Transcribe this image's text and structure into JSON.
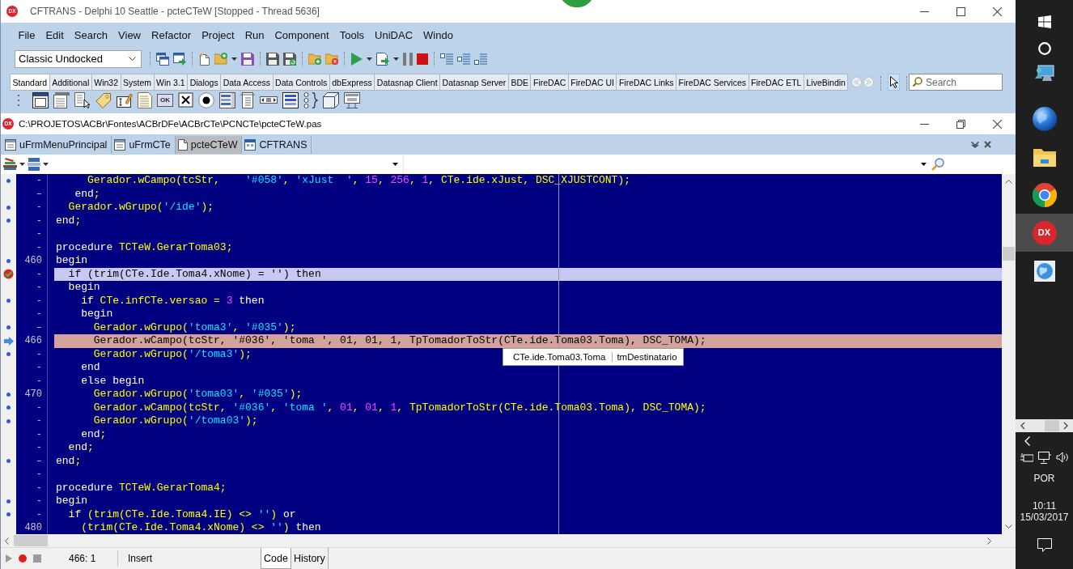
{
  "window": {
    "logo_text": "DX",
    "title": "CFTRANS - Delphi 10 Seattle - pcteCTeW [Stopped - Thread 5636]"
  },
  "menu": [
    "File",
    "Edit",
    "Search",
    "View",
    "Refactor",
    "Project",
    "Run",
    "Component",
    "Tools",
    "UniDAC",
    "Windo"
  ],
  "toolbar": {
    "desktop_layout": "Classic Undocked"
  },
  "component_palette": {
    "tabs": [
      {
        "label": "Standard",
        "selected": true
      },
      {
        "label": "Additional",
        "selected": false
      },
      {
        "label": "Win32",
        "selected": false
      },
      {
        "label": "System",
        "selected": false
      },
      {
        "label": "Win 3.1",
        "selected": false
      },
      {
        "label": "Dialogs",
        "selected": false
      },
      {
        "label": "Data Access",
        "selected": false
      },
      {
        "label": "Data Controls",
        "selected": false
      },
      {
        "label": "dbExpress",
        "selected": false
      },
      {
        "label": "Datasnap Client",
        "selected": false
      },
      {
        "label": "Datasnap Server",
        "selected": false
      },
      {
        "label": "BDE",
        "selected": false
      },
      {
        "label": "FireDAC",
        "selected": false
      },
      {
        "label": "FireDAC UI",
        "selected": false
      },
      {
        "label": "FireDAC Links",
        "selected": false
      },
      {
        "label": "FireDAC Services",
        "selected": false
      },
      {
        "label": "FireDAC ETL",
        "selected": false
      },
      {
        "label": "LiveBindin",
        "selected": false
      }
    ],
    "search": {
      "placeholder": "Search"
    },
    "button_icon_caption": "OK"
  },
  "editor": {
    "logo_text": "DX",
    "path": "C:\\PROJETOS\\ACBr\\Fontes\\ACBrDFe\\ACBrCTe\\PCNCTe\\pcteCTeW.pas",
    "tabs": [
      {
        "label": "uFrmMenuPrincipal",
        "kind": "form",
        "selected": false
      },
      {
        "label": "uFrmCTe",
        "kind": "form",
        "selected": false
      },
      {
        "label": "pcteCTeW",
        "kind": "unit",
        "selected": true
      },
      {
        "label": "CFTRANS",
        "kind": "project",
        "selected": false
      }
    ],
    "lines": [
      {
        "number": "-",
        "kind": "compiled",
        "tokens": [
          {
            "kind": "identifier",
            "text": "     Gerador.wCampo(tcStr,    "
          },
          {
            "kind": "string",
            "text": "'#058'"
          },
          {
            "kind": "identifier",
            "text": ", "
          },
          {
            "kind": "string",
            "text": "'xJust  '"
          },
          {
            "kind": "identifier",
            "text": ", "
          },
          {
            "kind": "number",
            "text": "15"
          },
          {
            "kind": "identifier",
            "text": ", "
          },
          {
            "kind": "number",
            "text": "256"
          },
          {
            "kind": "identifier",
            "text": ", "
          },
          {
            "kind": "number",
            "text": "1"
          },
          {
            "kind": "identifier",
            "text": ", CTe.ide.xJust, DSC_XJUSTCONT);"
          }
        ]
      },
      {
        "number": "–",
        "kind": "plain",
        "tokens": [
          {
            "kind": "keyword",
            "text": "   end"
          },
          {
            "kind": "identifier",
            "text": ";"
          }
        ]
      },
      {
        "number": "-",
        "kind": "compiled",
        "tokens": [
          {
            "kind": "identifier",
            "text": "  Gerador.wGrupo("
          },
          {
            "kind": "string",
            "text": "'/ide'"
          },
          {
            "kind": "identifier",
            "text": ");"
          }
        ]
      },
      {
        "number": "-",
        "kind": "compiled",
        "tokens": [
          {
            "kind": "keyword",
            "text": "end"
          },
          {
            "kind": "identifier",
            "text": ";"
          }
        ]
      },
      {
        "number": "-",
        "kind": "plain"
      },
      {
        "number": "-",
        "kind": "plain",
        "tokens": [
          {
            "kind": "keyword",
            "text": "procedure "
          },
          {
            "kind": "identifier",
            "text": "TCTeW.GerarToma03;"
          }
        ]
      },
      {
        "number": "460",
        "kind": "compiled",
        "tokens": [
          {
            "kind": "keyword",
            "text": "begin"
          }
        ]
      },
      {
        "number": "-",
        "kind": "breakpoint",
        "tokens": [
          {
            "kind": "keyword",
            "text": "  if "
          },
          {
            "kind": "identifier",
            "text": "(trim(CTe.Ide.Toma4.xNome) = "
          },
          {
            "kind": "string",
            "text": "''"
          },
          {
            "kind": "identifier",
            "text": ") "
          },
          {
            "kind": "keyword",
            "text": "then"
          }
        ]
      },
      {
        "number": "-",
        "kind": "plain",
        "tokens": [
          {
            "kind": "keyword",
            "text": "  begin"
          }
        ]
      },
      {
        "number": "-",
        "kind": "compiled",
        "tokens": [
          {
            "kind": "keyword",
            "text": "    if "
          },
          {
            "kind": "identifier",
            "text": "CTe.infCTe.versao = "
          },
          {
            "kind": "number",
            "text": "3"
          },
          {
            "kind": "keyword",
            "text": " then"
          }
        ]
      },
      {
        "number": "-",
        "kind": "plain",
        "tokens": [
          {
            "kind": "keyword",
            "text": "    begin"
          }
        ]
      },
      {
        "number": "–",
        "kind": "compiled",
        "tokens": [
          {
            "kind": "identifier",
            "text": "      Gerador.wGrupo("
          },
          {
            "kind": "string",
            "text": "'toma3'"
          },
          {
            "kind": "identifier",
            "text": ", "
          },
          {
            "kind": "string",
            "text": "'#035'"
          },
          {
            "kind": "identifier",
            "text": ");"
          }
        ]
      },
      {
        "number": "466",
        "kind": "current",
        "tokens": [
          {
            "kind": "identifier",
            "text": "      Gerador.wCampo(tcStr, "
          },
          {
            "kind": "string",
            "text": "'#036'"
          },
          {
            "kind": "identifier",
            "text": ", "
          },
          {
            "kind": "string",
            "text": "'toma '"
          },
          {
            "kind": "identifier",
            "text": ", "
          },
          {
            "kind": "number",
            "text": "01"
          },
          {
            "kind": "identifier",
            "text": ", "
          },
          {
            "kind": "number",
            "text": "01"
          },
          {
            "kind": "identifier",
            "text": ", "
          },
          {
            "kind": "number",
            "text": "1"
          },
          {
            "kind": "identifier",
            "text": ", TpTomadorToStr(CTe.ide.Toma03.Toma), DSC_TOMA);"
          }
        ]
      },
      {
        "number": "-",
        "kind": "compiled",
        "tokens": [
          {
            "kind": "identifier",
            "text": "      Gerador.wGrupo("
          },
          {
            "kind": "string",
            "text": "'/toma3'"
          },
          {
            "kind": "identifier",
            "text": ");"
          }
        ]
      },
      {
        "number": "-",
        "kind": "plain",
        "tokens": [
          {
            "kind": "keyword",
            "text": "    end"
          }
        ]
      },
      {
        "number": "-",
        "kind": "plain",
        "tokens": [
          {
            "kind": "keyword",
            "text": "    else begin"
          }
        ]
      },
      {
        "number": "470",
        "kind": "compiled",
        "tokens": [
          {
            "kind": "identifier",
            "text": "      Gerador.wGrupo("
          },
          {
            "kind": "string",
            "text": "'toma03'"
          },
          {
            "kind": "identifier",
            "text": ", "
          },
          {
            "kind": "string",
            "text": "'#035'"
          },
          {
            "kind": "identifier",
            "text": ");"
          }
        ]
      },
      {
        "number": "-",
        "kind": "compiled",
        "tokens": [
          {
            "kind": "identifier",
            "text": "      Gerador.wCampo(tcStr, "
          },
          {
            "kind": "string",
            "text": "'#036'"
          },
          {
            "kind": "identifier",
            "text": ", "
          },
          {
            "kind": "string",
            "text": "'toma '"
          },
          {
            "kind": "identifier",
            "text": ", "
          },
          {
            "kind": "number",
            "text": "01"
          },
          {
            "kind": "identifier",
            "text": ", "
          },
          {
            "kind": "number",
            "text": "01"
          },
          {
            "kind": "identifier",
            "text": ", "
          },
          {
            "kind": "number",
            "text": "1"
          },
          {
            "kind": "identifier",
            "text": ", TpTomadorToStr(CTe.ide.Toma03.Toma), DSC_TOMA);"
          }
        ]
      },
      {
        "number": "-",
        "kind": "compiled",
        "tokens": [
          {
            "kind": "identifier",
            "text": "      Gerador.wGrupo("
          },
          {
            "kind": "string",
            "text": "'/toma03'"
          },
          {
            "kind": "identifier",
            "text": ");"
          }
        ]
      },
      {
        "number": "-",
        "kind": "plain",
        "tokens": [
          {
            "kind": "keyword",
            "text": "    end"
          },
          {
            "kind": "identifier",
            "text": ";"
          }
        ]
      },
      {
        "number": "-",
        "kind": "plain",
        "tokens": [
          {
            "kind": "keyword",
            "text": "  end"
          },
          {
            "kind": "identifier",
            "text": ";"
          }
        ]
      },
      {
        "number": "–",
        "kind": "compiled",
        "tokens": [
          {
            "kind": "keyword",
            "text": "end"
          },
          {
            "kind": "identifier",
            "text": ";"
          }
        ]
      },
      {
        "number": "-",
        "kind": "plain"
      },
      {
        "number": "-",
        "kind": "plain",
        "tokens": [
          {
            "kind": "keyword",
            "text": "procedure "
          },
          {
            "kind": "identifier",
            "text": "TCTeW.GerarToma4;"
          }
        ]
      },
      {
        "number": "-",
        "kind": "compiled",
        "tokens": [
          {
            "kind": "keyword",
            "text": "begin"
          }
        ]
      },
      {
        "number": "-",
        "kind": "compiled",
        "tokens": [
          {
            "kind": "keyword",
            "text": "  if "
          },
          {
            "kind": "identifier",
            "text": "(trim(CTe.Ide.Toma4.IE) <> "
          },
          {
            "kind": "string",
            "text": "''"
          },
          {
            "kind": "identifier",
            "text": ") "
          },
          {
            "kind": "keyword",
            "text": "or"
          }
        ]
      },
      {
        "number": "480",
        "kind": "plain",
        "tokens": [
          {
            "kind": "identifier",
            "text": "    (trim(CTe.Ide.Toma4.xNome) <> "
          },
          {
            "kind": "string",
            "text": "''"
          },
          {
            "kind": "identifier",
            "text": ") "
          },
          {
            "kind": "keyword",
            "text": "then"
          }
        ]
      }
    ],
    "hint": {
      "expression": "CTe.ide.Toma03.Toma",
      "value": "tmDestinatario"
    },
    "status": {
      "position": "466: 1",
      "mode": "Insert"
    },
    "view_tabs": [
      {
        "label": "Code",
        "selected": true
      },
      {
        "label": "History",
        "selected": false
      }
    ]
  },
  "taskbar": {
    "apps": [
      {
        "kind": "globe",
        "selected": false
      },
      {
        "kind": "folder",
        "selected": false
      },
      {
        "kind": "browser",
        "selected": false
      },
      {
        "kind": "ide",
        "label": "DX",
        "selected": true
      },
      {
        "kind": "globe_tile",
        "selected": false
      }
    ],
    "language": "POR",
    "time": "10:11",
    "date": "15/03/2017"
  }
}
